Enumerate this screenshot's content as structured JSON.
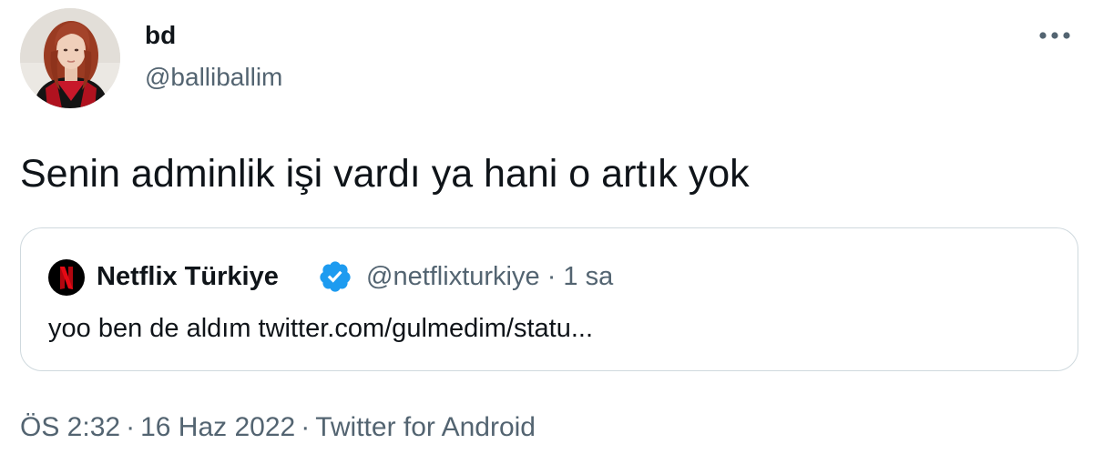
{
  "author": {
    "display_name": "bd",
    "handle": "@balliballim",
    "avatar_icon": "profile-photo"
  },
  "tweet": {
    "text": "Senin adminlik işi vardı ya hani o artık yok"
  },
  "more_menu_icon": "more-horizontal-icon",
  "quoted_tweet": {
    "avatar_icon": "netflix-logo",
    "display_name": "Netflix Türkiye",
    "verified_icon": "verified-badge-icon",
    "handle": "@netflixturkiye",
    "separator": "·",
    "time": "1 sa",
    "text": "yoo ben de aldım twitter.com/gulmedim/statu..."
  },
  "footer": {
    "time": "ÖS 2:32",
    "date": "16 Haz 2022",
    "source": "Twitter for Android",
    "separator": "·"
  },
  "colors": {
    "text_primary": "#0f1419",
    "text_secondary": "#536471",
    "border": "#cfd9de",
    "verified_blue": "#1d9bf0",
    "netflix_red": "#e50914"
  }
}
